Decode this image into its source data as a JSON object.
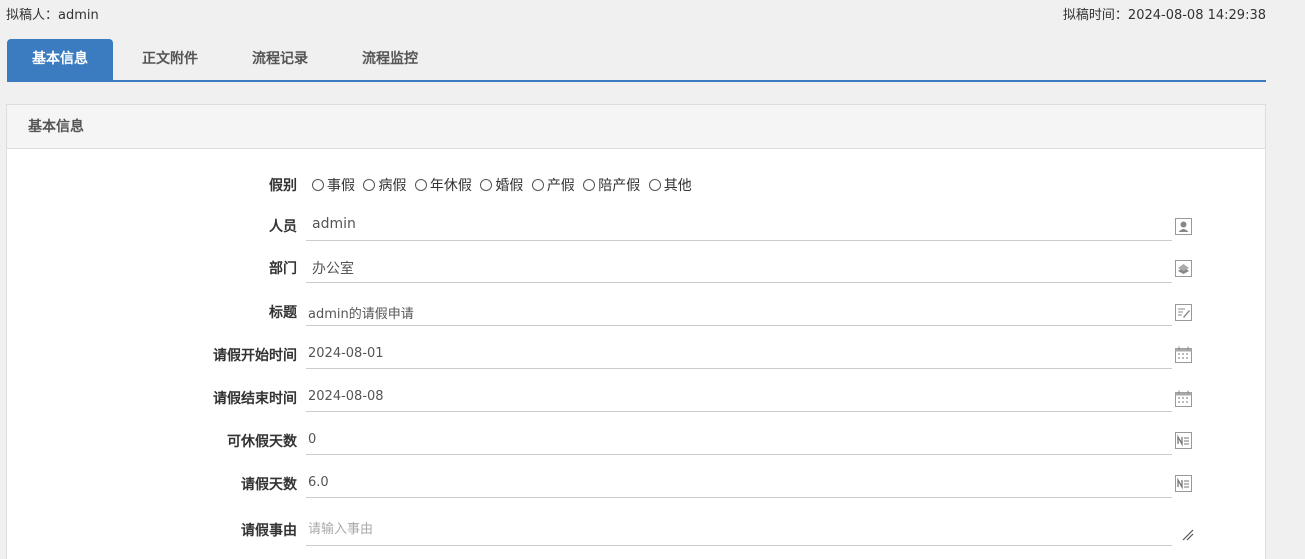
{
  "header": {
    "drafter": "拟稿人：admin",
    "draft_time": "拟稿时间：2024-08-08 14:29:38"
  },
  "tabs": [
    {
      "label": "基本信息",
      "active": true
    },
    {
      "label": "正文附件",
      "active": false
    },
    {
      "label": "流程记录",
      "active": false
    },
    {
      "label": "流程监控",
      "active": false
    }
  ],
  "panel": {
    "title": "基本信息"
  },
  "form": {
    "leave_type": {
      "label": "假别",
      "options": [
        "事假",
        "病假",
        "年休假",
        "婚假",
        "产假",
        "陪产假",
        "其他"
      ]
    },
    "person": {
      "label": "人员",
      "value": "admin",
      "icon": "user-icon"
    },
    "department": {
      "label": "部门",
      "value": "办公室",
      "icon": "department-icon"
    },
    "title": {
      "label": "标题",
      "value": "admin的请假申请",
      "icon": "edit-icon"
    },
    "start_time": {
      "label": "请假开始时间",
      "value": "2024-08-01",
      "icon": "calendar-icon"
    },
    "end_time": {
      "label": "请假结束时间",
      "value": "2024-08-08",
      "icon": "calendar-icon"
    },
    "available_days": {
      "label": "可休假天数",
      "value": "0",
      "icon": "number-icon"
    },
    "leave_days": {
      "label": "请假天数",
      "value": "6.0",
      "icon": "number-icon"
    },
    "reason": {
      "label": "请假事由",
      "placeholder": "请输入事由",
      "icon": "resize-icon"
    }
  }
}
